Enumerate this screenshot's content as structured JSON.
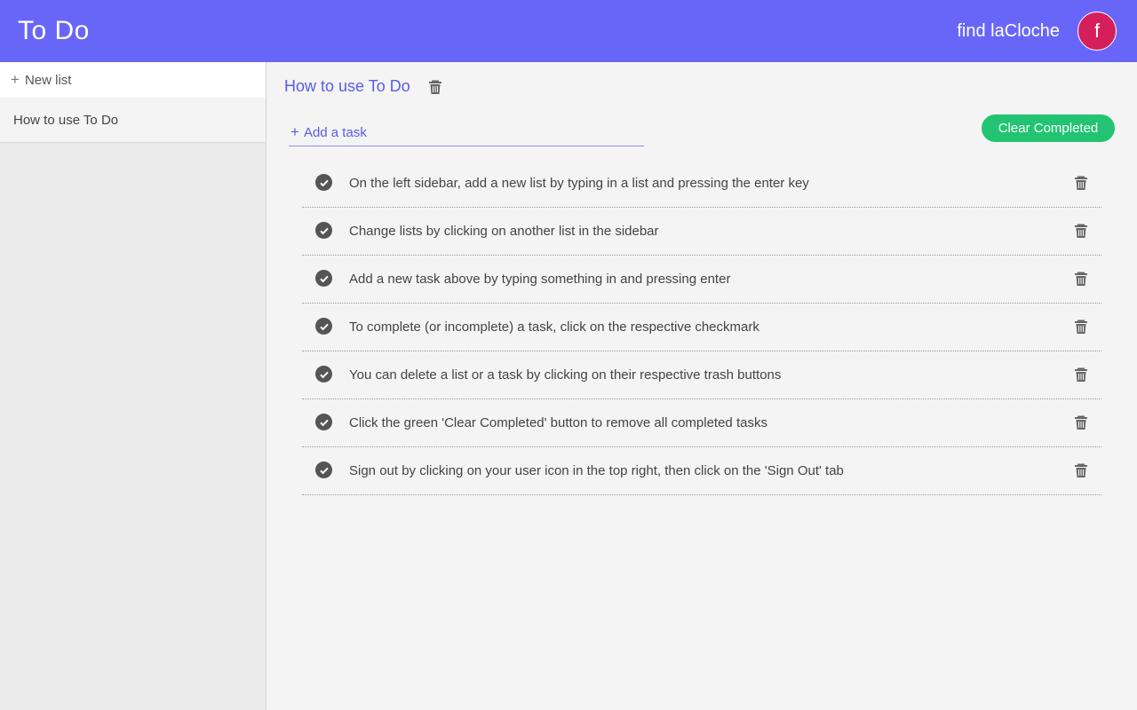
{
  "header": {
    "app_title": "To Do",
    "user_name": "find laCloche",
    "avatar_letter": "f",
    "accent_color": "#6866f9",
    "avatar_color": "#d41f5c"
  },
  "sidebar": {
    "new_list_icon": "plus-icon",
    "new_list_label": "New list",
    "items": [
      {
        "label": "How to use To Do"
      }
    ]
  },
  "main": {
    "list_title": "How to use To Do",
    "list_delete_icon": "trash-icon",
    "add_task_icon": "plus-icon",
    "add_task_label": "Add a task",
    "clear_completed_label": "Clear Completed",
    "clear_completed_color": "#22c472",
    "tasks": [
      {
        "text": "On the left sidebar, add a new list by typing in a list and pressing the enter key",
        "completed": true
      },
      {
        "text": "Change lists by clicking on another list in the sidebar",
        "completed": true
      },
      {
        "text": "Add a new task above by typing something in and pressing enter",
        "completed": true
      },
      {
        "text": "To complete (or incomplete) a task, click on the respective checkmark",
        "completed": true
      },
      {
        "text": "You can delete a list or a task by clicking on their respective trash buttons",
        "completed": true
      },
      {
        "text": "Click the green 'Clear Completed' button to remove all completed tasks",
        "completed": true
      },
      {
        "text": "Sign out by clicking on your user icon in the top right, then click on the 'Sign Out' tab",
        "completed": true
      }
    ]
  }
}
